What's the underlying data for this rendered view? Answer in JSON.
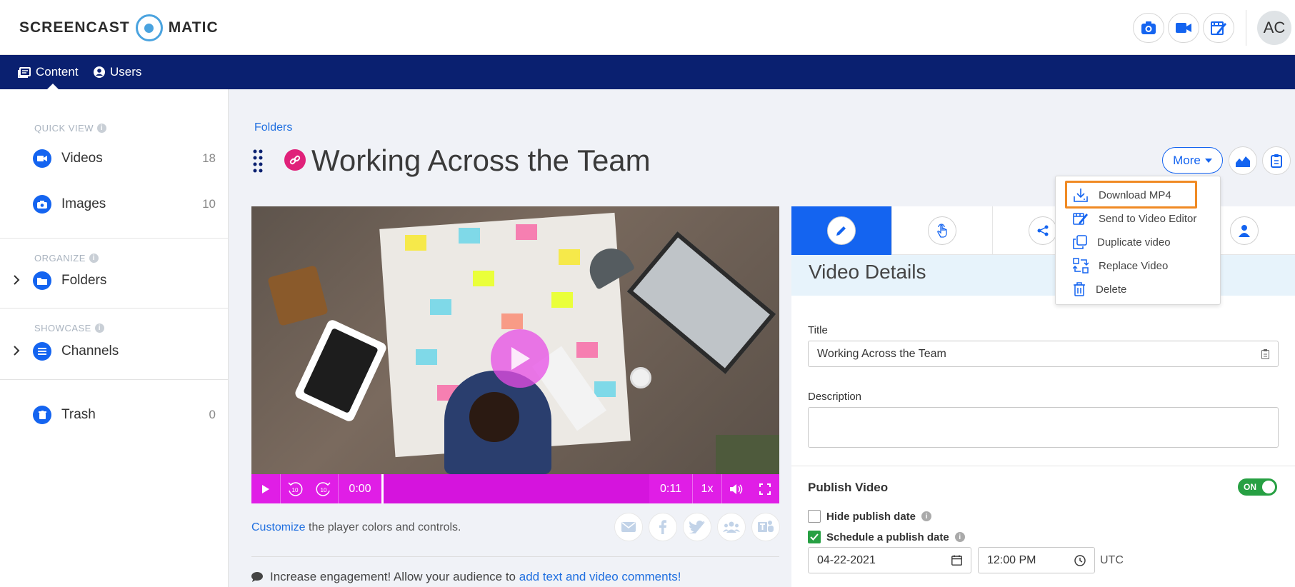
{
  "brand": {
    "left": "SCREENCAST",
    "right": "MATIC",
    "colors": {
      "logo_blue": "#4aa3df",
      "nav_navy": "#0a2070",
      "accent_blue": "#1464f0",
      "player_magenta": "#e01ee6",
      "link_pink": "#e0217a",
      "success_green": "#27a043",
      "highlight_orange": "#f08a24"
    }
  },
  "topbar": {
    "icons": [
      "camera-icon",
      "video-camera-icon",
      "video-edit-icon"
    ],
    "avatar": "AC"
  },
  "nav": {
    "items": [
      {
        "label": "Content",
        "icon": "content-icon",
        "active": true
      },
      {
        "label": "Users",
        "icon": "user-circle-icon",
        "active": false
      }
    ]
  },
  "sidebar": {
    "quick_view": {
      "heading": "QUICK VIEW",
      "items": [
        {
          "label": "Videos",
          "count": "18",
          "icon": "video-icon"
        },
        {
          "label": "Images",
          "count": "10",
          "icon": "camera-icon"
        }
      ]
    },
    "organize": {
      "heading": "ORGANIZE",
      "items": [
        {
          "label": "Folders",
          "icon": "folder-icon"
        }
      ]
    },
    "showcase": {
      "heading": "SHOWCASE",
      "items": [
        {
          "label": "Channels",
          "icon": "list-icon"
        }
      ]
    },
    "trash": {
      "label": "Trash",
      "count": "0",
      "icon": "trash-icon"
    }
  },
  "main": {
    "breadcrumb": "Folders",
    "title": "Working Across the Team",
    "more_label": "More",
    "actions": [
      "analytics-icon",
      "clipboard-icon"
    ]
  },
  "more_menu": {
    "items": [
      {
        "label": "Download MP4",
        "icon": "download-icon",
        "highlighted": true
      },
      {
        "label": "Send to Video Editor",
        "icon": "video-edit-icon"
      },
      {
        "label": "Duplicate video",
        "icon": "duplicate-icon"
      },
      {
        "label": "Replace Video",
        "icon": "replace-icon"
      },
      {
        "label": "Delete",
        "icon": "trash-icon"
      }
    ]
  },
  "player": {
    "current_time": "0:00",
    "duration": "0:11",
    "speed": "1x",
    "progress": 0,
    "rewind_label": "10",
    "forward_label": "10"
  },
  "below_video": {
    "customize_link": "Customize",
    "customize_text": " the player colors and controls.",
    "share_icons": [
      "email-icon",
      "facebook-icon",
      "twitter-icon",
      "group-icon",
      "teams-icon"
    ],
    "engage_text": "Increase engagement! Allow your audience to ",
    "engage_link": "add text and video comments!"
  },
  "details": {
    "tabs": [
      "edit-icon",
      "interaction-icon",
      "share-icon",
      "person-icon"
    ],
    "section_title": "Video Details",
    "title_label": "Title",
    "title_value": "Working Across the Team",
    "description_label": "Description",
    "description_value": "",
    "publish_title": "Publish Video",
    "publish_toggle": "ON",
    "hide_publish_date": "Hide publish date",
    "schedule_publish_date": "Schedule a publish date",
    "date_value": "04-22-2021",
    "time_value": "12:00 PM",
    "timezone": "UTC"
  }
}
